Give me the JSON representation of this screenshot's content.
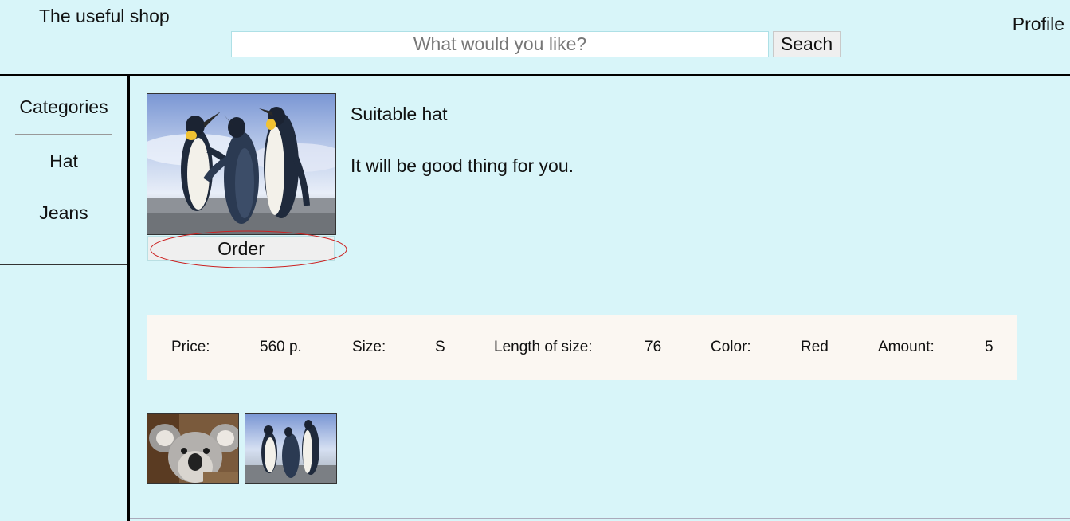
{
  "header": {
    "shop_title": "The useful shop",
    "search_placeholder": "What would you like?",
    "search_value": "",
    "search_button_label": "Seach",
    "profile_label": "Profile"
  },
  "sidebar": {
    "heading": "Categories",
    "items": [
      {
        "label": "Hat"
      },
      {
        "label": "Jeans"
      }
    ]
  },
  "product": {
    "name": "Suitable hat",
    "description": "It will be good thing for you.",
    "image": "penguins-photo",
    "order_button_label": "Order",
    "specs": [
      {
        "label": "Price:",
        "value": "560 p."
      },
      {
        "label": "Size:",
        "value": "S"
      },
      {
        "label": "Length of size:",
        "value": "76"
      },
      {
        "label": "Color:",
        "value": "Red"
      },
      {
        "label": "Amount:",
        "value": "5"
      }
    ],
    "thumbnails": [
      {
        "image": "koala-photo"
      },
      {
        "image": "penguins-photo"
      }
    ]
  },
  "colors": {
    "page_background": "#d8f5f9",
    "specs_background": "#fbf7f2",
    "button_background": "#efefef",
    "highlight_ellipse": "#cc2222",
    "divider": "#000000"
  }
}
